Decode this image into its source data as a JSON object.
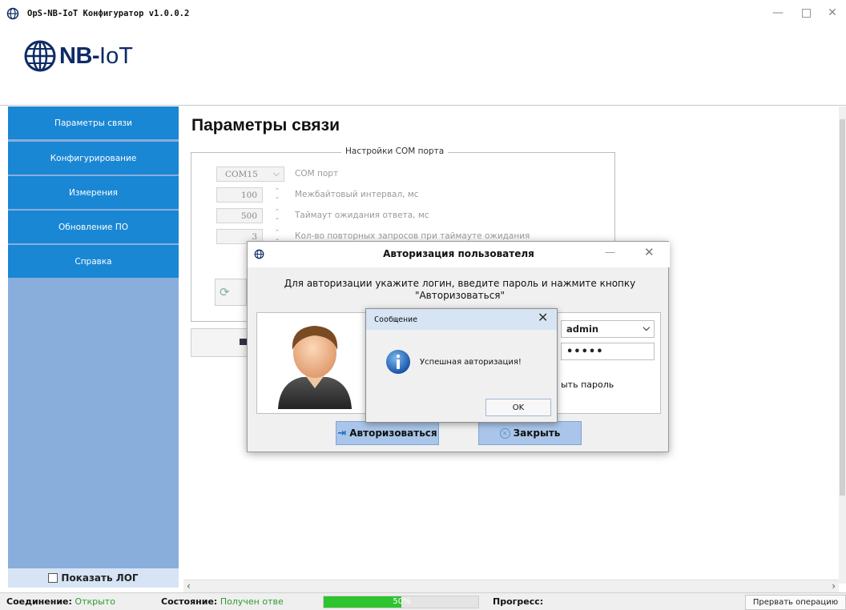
{
  "window": {
    "title": "OpS-NB-IoT Конфигуратор v1.0.0.2"
  },
  "header": {
    "logo_bold": "NB-",
    "logo_rest": "IoT"
  },
  "sidebar": {
    "items": [
      {
        "label": "Параметры связи"
      },
      {
        "label": "Конфигурирование"
      },
      {
        "label": "Измерения"
      },
      {
        "label": "Обновление ПО"
      },
      {
        "label": "Справка"
      }
    ],
    "show_log_label": "Показать ЛОГ"
  },
  "main": {
    "title": "Параметры связи",
    "com_group_title": "Настройки COM порта",
    "fields": [
      {
        "value": "COM15",
        "label": "COM порт"
      },
      {
        "value": "100",
        "label": "Межбайтовый интервал, мс"
      },
      {
        "value": "500",
        "label": "Таймаут ожидания ответа, мс"
      },
      {
        "value": "3",
        "label": "Кол-во повторных запросов при таймауте ожидания"
      }
    ]
  },
  "auth_dialog": {
    "title": "Авторизация пользователя",
    "message": "Для авторизации укажите логин, введите пароль и нажмите кнопку \"Авторизоваться\"",
    "login_value": "admin",
    "password_mask": "•••••",
    "show_password_partial": "ыть пароль",
    "authorize_label": "Авторизоваться",
    "close_label": "Закрыть"
  },
  "message_dialog": {
    "title": "Сообщение",
    "text": "Успешная авторизация!",
    "ok_label": "OK"
  },
  "statusbar": {
    "connection_label": "Соединение:",
    "connection_value": "Открыто",
    "state_label": "Состояние:",
    "state_value": "Получен отве",
    "progress_text": "50%",
    "progress_fraction": 0.5,
    "progress_label": "Прогресс:",
    "abort_label": "Прервать операцию"
  },
  "colors": {
    "sidebar_item": "#1a87d4",
    "sidebar_bg": "#8aaedb",
    "button_blue": "#a9c6ea",
    "progress_green": "#2ec42e",
    "status_green": "#2e9a2e"
  }
}
